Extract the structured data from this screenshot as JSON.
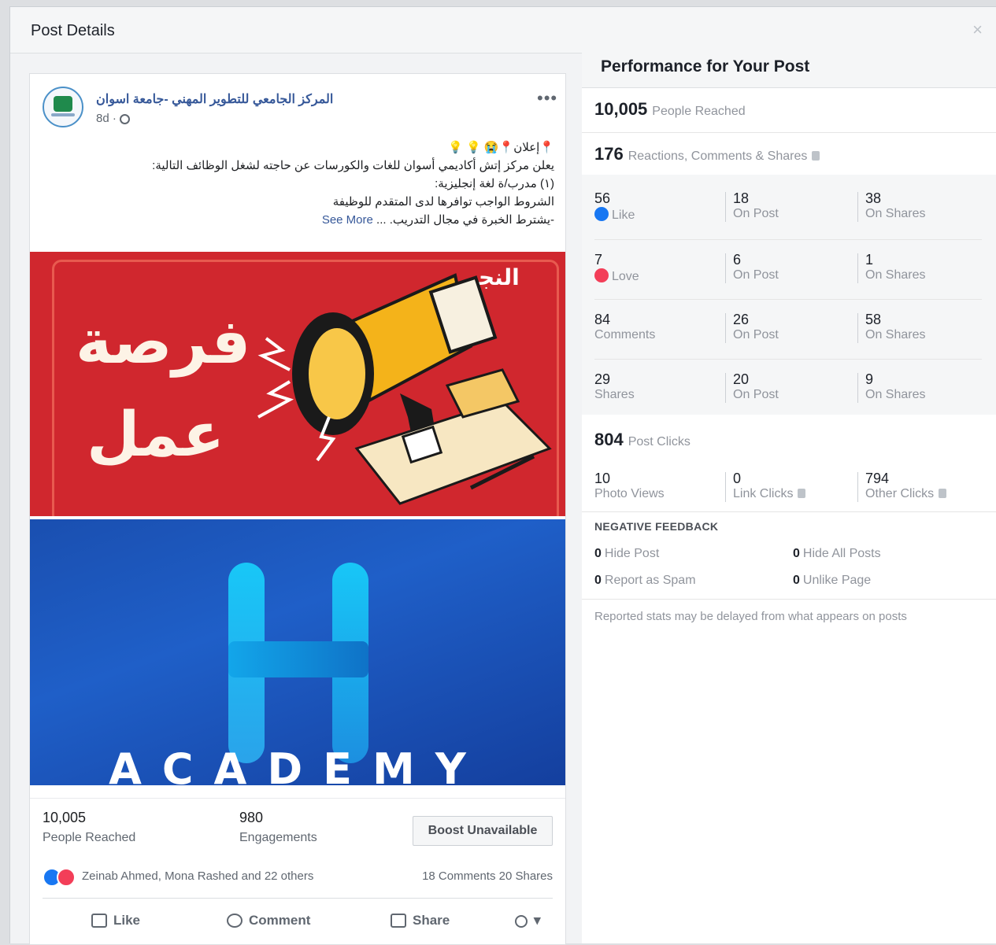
{
  "dialog": {
    "title": "Post Details",
    "close_glyph": "×"
  },
  "post": {
    "page_name": "المركز الجامعي للتطوير المهني -جامعة اسوان",
    "time": "8d ·",
    "more_glyph": "•••",
    "text_lines": [
      "📍إعلان📍😭 💡 💡",
      "يعلن مركز إتش أكاديمي أسوان للغات والكورسات عن حاجته لشغل الوظائف التالية:",
      "(١) مدرب/ة لغة إنجليزية:",
      "الشروط الواجب توافرها لدى المتقدم للوظيفة",
      "-يشترط الخبرة في مجال التدريب. ..."
    ],
    "see_more": "See More",
    "image1": {
      "line1": "فرصة",
      "line2": "عمل",
      "brand": "النجم"
    },
    "image2": {
      "brand": "ACADEMY"
    },
    "reached_num": "10,005",
    "reached_label": "People Reached",
    "engagements_num": "980",
    "engagements_label": "Engagements",
    "boost_label": "Boost Unavailable",
    "reaction_names": "Zeinab Ahmed, Mona Rashed and 22 others",
    "comments_shares": "18 Comments  20 Shares",
    "actions": {
      "like": "Like",
      "comment": "Comment",
      "share": "Share"
    }
  },
  "panel": {
    "title": "Performance for Your Post",
    "people_reached": {
      "num": "10,005",
      "label": "People Reached"
    },
    "reactions_total": {
      "num": "176",
      "label": "Reactions, Comments & Shares"
    },
    "grid": [
      [
        {
          "n": "56",
          "l": "Like"
        },
        {
          "n": "18",
          "l": "On Post"
        },
        {
          "n": "38",
          "l": "On Shares"
        }
      ],
      [
        {
          "n": "7",
          "l": "Love"
        },
        {
          "n": "6",
          "l": "On Post"
        },
        {
          "n": "1",
          "l": "On Shares"
        }
      ],
      [
        {
          "n": "84",
          "l": "Comments"
        },
        {
          "n": "26",
          "l": "On Post"
        },
        {
          "n": "58",
          "l": "On Shares"
        }
      ],
      [
        {
          "n": "29",
          "l": "Shares"
        },
        {
          "n": "20",
          "l": "On Post"
        },
        {
          "n": "9",
          "l": "On Shares"
        }
      ]
    ],
    "post_clicks": {
      "num": "804",
      "label": "Post Clicks"
    },
    "clicks": [
      {
        "n": "10",
        "l": "Photo Views"
      },
      {
        "n": "0",
        "l": "Link Clicks"
      },
      {
        "n": "794",
        "l": "Other Clicks"
      }
    ],
    "negative_title": "NEGATIVE FEEDBACK",
    "negative": [
      {
        "n": "0",
        "l": "Hide Post"
      },
      {
        "n": "0",
        "l": "Hide All Posts"
      },
      {
        "n": "0",
        "l": "Report as Spam"
      },
      {
        "n": "0",
        "l": "Unlike Page"
      }
    ],
    "note": "Reported stats may be delayed from what appears on posts"
  },
  "colors": {
    "link": "#365899",
    "like_blue": "#1877f2",
    "love_red": "#f33e58",
    "image_red": "#d0272e",
    "image_blue": "#1a4fb0"
  }
}
